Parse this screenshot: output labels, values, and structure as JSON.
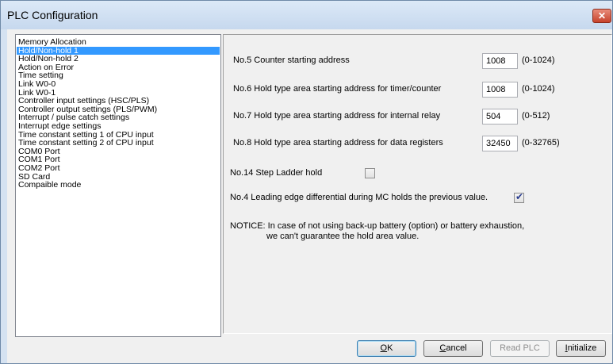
{
  "window": {
    "title": "PLC Configuration",
    "close_glyph": "✕"
  },
  "nav": {
    "items": [
      {
        "label": "Memory Allocation",
        "selected": false
      },
      {
        "label": "Hold/Non-hold 1",
        "selected": true
      },
      {
        "label": "Hold/Non-hold 2",
        "selected": false
      },
      {
        "label": "Action on Error",
        "selected": false
      },
      {
        "label": "Time setting",
        "selected": false
      },
      {
        "label": "Link W0-0",
        "selected": false
      },
      {
        "label": "Link W0-1",
        "selected": false
      },
      {
        "label": "Controller input settings (HSC/PLS)",
        "selected": false
      },
      {
        "label": "Controller output settings (PLS/PWM)",
        "selected": false
      },
      {
        "label": "Interrupt / pulse catch settings",
        "selected": false
      },
      {
        "label": "Interrupt edge settings",
        "selected": false
      },
      {
        "label": "Time constant setting 1 of CPU input",
        "selected": false
      },
      {
        "label": "Time constant setting 2 of CPU input",
        "selected": false
      },
      {
        "label": "COM0 Port",
        "selected": false
      },
      {
        "label": "COM1 Port",
        "selected": false
      },
      {
        "label": "COM2 Port",
        "selected": false
      },
      {
        "label": "SD Card",
        "selected": false
      },
      {
        "label": "Compaible mode",
        "selected": false
      }
    ]
  },
  "settings": {
    "rows": [
      {
        "label": "No.5 Counter starting address",
        "value": "1008",
        "range": "(0-1024)"
      },
      {
        "label": "No.6 Hold type area starting address for timer/counter",
        "value": "1008",
        "range": "(0-1024)"
      },
      {
        "label": "No.7 Hold type area starting address for internal relay",
        "value": "504",
        "range": "(0-512)"
      },
      {
        "label": "No.8 Hold type area starting address for data registers",
        "value": "32450",
        "range": "(0-32765)"
      }
    ],
    "step_ladder_hold": {
      "label": "No.14 Step Ladder hold",
      "checked": false
    },
    "leading_edge": {
      "label": "No.4 Leading edge differential during MC holds the previous value.",
      "checked": true
    },
    "notice_line1": "NOTICE: In case of not using back-up battery (option) or battery exhaustion,",
    "notice_line2": "we can't guarantee the hold area value.",
    "check_glyph": "✔"
  },
  "buttons": {
    "ok": {
      "mnemonic": "O",
      "rest": "K"
    },
    "cancel": {
      "mnemonic": "C",
      "rest": "ancel"
    },
    "read_plc": {
      "label": "Read PLC"
    },
    "initialize": {
      "mnemonic": "I",
      "rest": "nitialize"
    }
  }
}
